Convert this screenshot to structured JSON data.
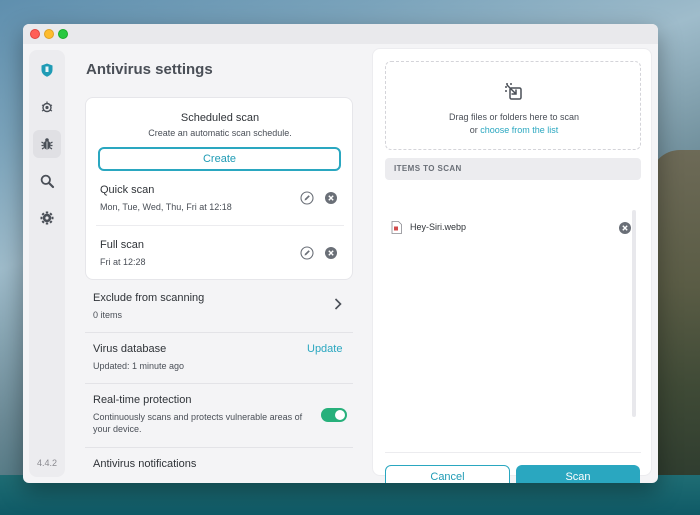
{
  "window": {
    "title": ""
  },
  "sidebar": {
    "items": [
      {
        "name": "shield-icon",
        "color": "#1f9bb5"
      },
      {
        "name": "bug-scan-icon"
      },
      {
        "name": "bug-icon",
        "active": true
      },
      {
        "name": "magnifier-icon"
      },
      {
        "name": "gear-icon"
      }
    ],
    "version": "4.4.2"
  },
  "page": {
    "title": "Antivirus settings"
  },
  "scheduled": {
    "title": "Scheduled scan",
    "subtitle": "Create an automatic scan schedule.",
    "create_label": "Create",
    "scans": [
      {
        "name": "Quick scan",
        "when": "Mon, Tue, Wed, Thu, Fri at 12:18"
      },
      {
        "name": "Full scan",
        "when": "Fri at 12:28"
      }
    ]
  },
  "settings": {
    "exclude": {
      "title": "Exclude from scanning",
      "sub": "0 items"
    },
    "database": {
      "title": "Virus database",
      "sub": "Updated: 1 minute ago",
      "action": "Update"
    },
    "realtime": {
      "title": "Real-time protection",
      "sub": "Continuously scans and protects vulnerable areas of your device.",
      "enabled": true
    },
    "notifications": {
      "title": "Antivirus notifications"
    }
  },
  "scan_panel": {
    "drop_text": "Drag files or folders here to scan",
    "drop_or": "or",
    "drop_link": "choose from the list",
    "items_header": "ITEMS TO SCAN",
    "items": [
      {
        "name": "Hey-Siri.webp"
      }
    ],
    "cancel_label": "Cancel",
    "scan_label": "Scan"
  },
  "colors": {
    "accent": "#2aa7c0",
    "toggle_on": "#27b07b"
  }
}
